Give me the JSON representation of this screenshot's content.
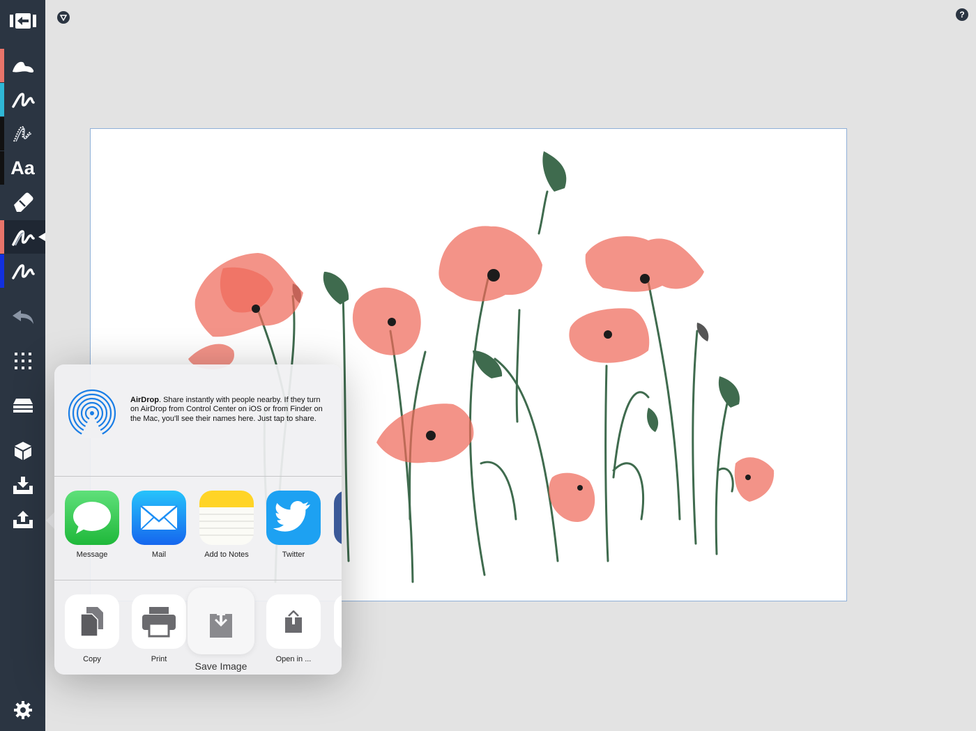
{
  "sidebar": {
    "tools": [
      {
        "name": "exit-icon"
      },
      {
        "name": "brush-blob-icon",
        "stripe": "#e8746a"
      },
      {
        "name": "pen-icon",
        "stripe": "#2fb7d6"
      },
      {
        "name": "pencil-icon",
        "stripe": "#111111"
      },
      {
        "name": "text-tool",
        "label": "Aa",
        "stripe": "#111111"
      },
      {
        "name": "eraser-icon"
      },
      {
        "name": "brush-selected-icon",
        "stripe": "#e8746a"
      },
      {
        "name": "pen-blue-icon",
        "stripe": "#1230e0"
      },
      {
        "name": "undo-icon"
      },
      {
        "name": "grid-icon"
      },
      {
        "name": "layers-icon"
      },
      {
        "name": "cube-icon"
      },
      {
        "name": "import-icon"
      },
      {
        "name": "export-icon"
      },
      {
        "name": "settings-icon"
      }
    ]
  },
  "top": {
    "help_label": "?"
  },
  "share": {
    "airdrop_title": "AirDrop",
    "airdrop_body": ". Share instantly with people nearby. If they turn on AirDrop from Control Center on iOS or from Finder on the Mac, you'll see their names here. Just tap to share.",
    "apps": [
      {
        "label": "Message",
        "icon": "message-icon",
        "color": "#34c759"
      },
      {
        "label": "Mail",
        "icon": "mail-icon",
        "color": "#1e8ff5"
      },
      {
        "label": "Add to Notes",
        "icon": "notes-icon",
        "color": "#ffd426"
      },
      {
        "label": "Twitter",
        "icon": "twitter-icon",
        "color": "#1da1f2"
      }
    ],
    "actions": [
      {
        "label": "Copy",
        "icon": "copy-icon"
      },
      {
        "label": "Print",
        "icon": "print-icon"
      },
      {
        "label": "Save Image",
        "icon": "save-image-icon"
      },
      {
        "label": "Open in ...",
        "icon": "open-in-icon"
      }
    ]
  },
  "colors": {
    "sidebar": "#2b3542",
    "poppy": "#ef6a5a",
    "stem": "#3f6b4e"
  }
}
